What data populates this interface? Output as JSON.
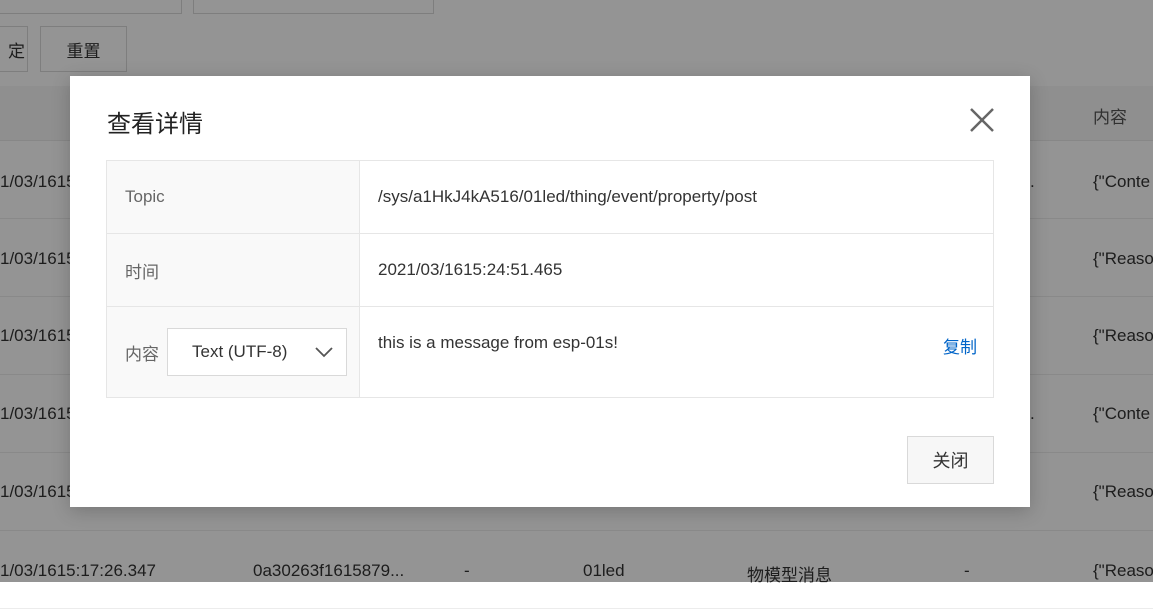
{
  "background": {
    "reset_label": "重置",
    "cut_button_label": "定",
    "columns": {
      "content": "内容"
    },
    "rows": [
      {
        "time": "1/03/1615",
        "content": "{\"Conte",
        "extra": "."
      },
      {
        "time": "1/03/1615",
        "content": "{\"Reaso"
      },
      {
        "time": "1/03/1615",
        "content": "{\"Reaso"
      },
      {
        "time": "1/03/1615",
        "content": "{\"Conte",
        "extra": "."
      },
      {
        "time": "1/03/1615",
        "content": "{\"Reaso"
      },
      {
        "time": "1/03/1615:17:26.347",
        "message_id": "0a30263f1615879...",
        "dash1": "-",
        "device": "01led",
        "type": "物模型消息",
        "dash2": "-",
        "content": "{\"Reaso"
      }
    ]
  },
  "modal": {
    "title": "查看详情",
    "topic_label": "Topic",
    "topic_value": "/sys/a1HkJ4kA516/01led/thing/event/property/post",
    "time_label": "时间",
    "time_value": "2021/03/1615:24:51.465",
    "content_label": "内容",
    "encoding_selected": "Text (UTF-8)",
    "content_value": "this is a message from esp-01s!",
    "copy_label": "复制",
    "close_label": "关闭"
  },
  "colors": {
    "link": "#0064c8",
    "overlay": "rgba(0,0,0,0.42)"
  }
}
